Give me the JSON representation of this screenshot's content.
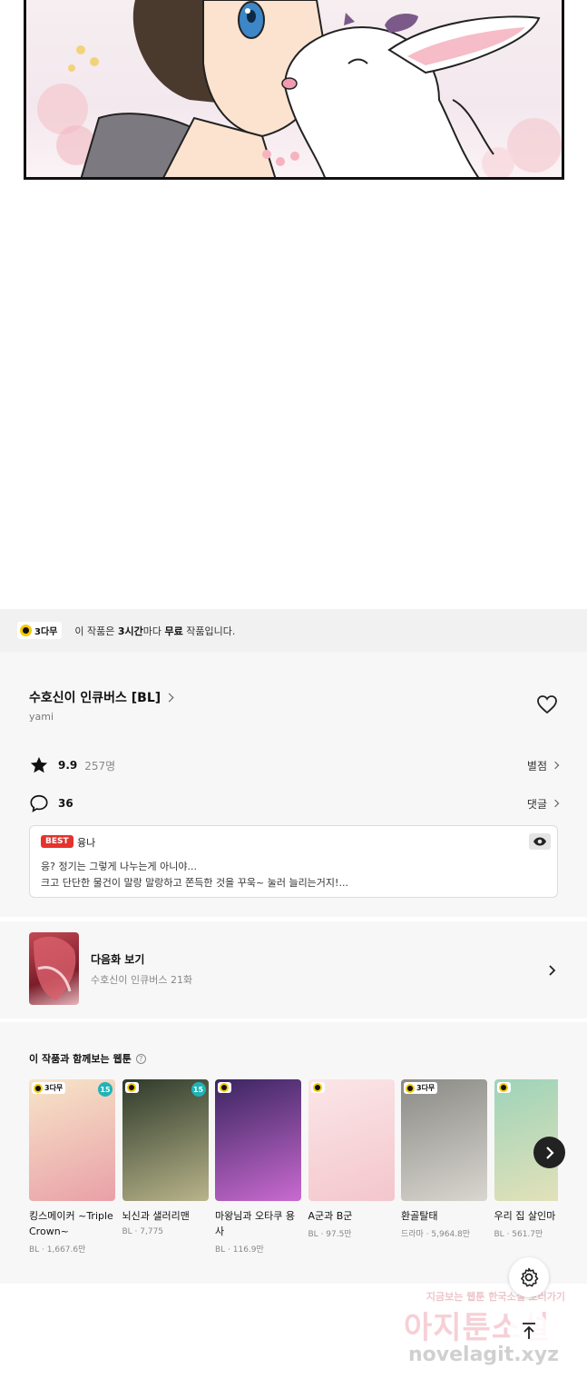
{
  "free_banner": {
    "badge": "3다무",
    "text_prefix": "이 작품은 ",
    "text_bold1": "3시간",
    "text_mid": "마다 ",
    "text_bold2": "무료",
    "text_suffix": " 작품입니다."
  },
  "series": {
    "title": "수호신이 인큐버스 [BL]",
    "author": "yami"
  },
  "rating": {
    "score": "9.9",
    "count": "257명",
    "link": "별점"
  },
  "comments": {
    "count": "36",
    "link": "댓글"
  },
  "best_comment": {
    "badge": "BEST",
    "user": "융나",
    "line1": "응? 정기는 그렇게 나누는게 아니야...",
    "line2": "크고 단단한 물건이 말랑 말랑하고 쫀득한 것을 꾸욱~ 눌러 늘리는거지!..."
  },
  "next_episode": {
    "label": "다음화 보기",
    "sub": "수호신이 인큐버스 21화"
  },
  "recommend": {
    "heading": "이 작품과 함께보는 웹툰",
    "help": "?",
    "items": [
      {
        "title": "킹스메이커 ~Triple Crown~",
        "meta": "BL · 1,667.6만",
        "tag": "3다무",
        "age": "15",
        "colors": [
          "#f7e5c8",
          "#e9a0a8"
        ]
      },
      {
        "title": "뇌신과 샐러리맨",
        "meta": "BL · 7,775",
        "tag": "",
        "age": "15",
        "colors": [
          "#2e3a2a",
          "#b8b48a"
        ]
      },
      {
        "title": "마왕님과 오타쿠 용사",
        "meta": "BL · 116.9만",
        "tag": "",
        "age": "",
        "colors": [
          "#3a2560",
          "#c96ad0"
        ]
      },
      {
        "title": "A군과 B군",
        "meta": "BL · 97.5만",
        "tag": "",
        "age": "",
        "colors": [
          "#fbe6e8",
          "#f3c6cc"
        ]
      },
      {
        "title": "환골탈태",
        "meta": "드라마 · 5,964.8만",
        "tag": "3다무",
        "age": "",
        "colors": [
          "#8a8a86",
          "#d9d6cf"
        ]
      },
      {
        "title": "우리 집 살인마",
        "meta": "BL · 561.7만",
        "tag": "",
        "age": "",
        "colors": [
          "#9ed3b9",
          "#e6e2b9"
        ]
      }
    ]
  },
  "watermark": {
    "small": "지금보는 웹툰 한국소설 보러가기",
    "big": "아지툰소설",
    "url": "novelagit.xyz"
  },
  "icons": {
    "heart": "heart-icon",
    "star": "star-icon",
    "comment": "comment-icon",
    "eye": "eye-icon",
    "settings": "gear-icon",
    "top": "arrow-up-icon"
  }
}
